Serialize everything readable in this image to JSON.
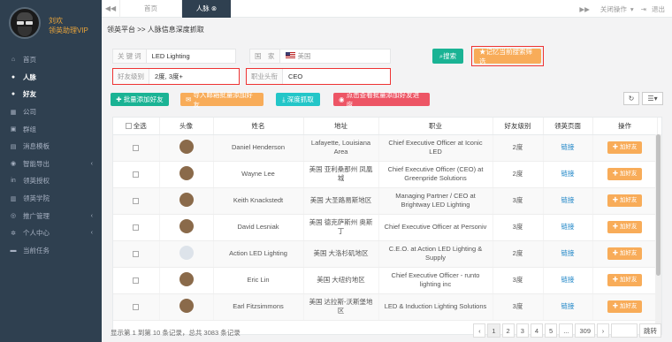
{
  "sidebar": {
    "user_name": "刘欢",
    "user_role": "领英助理VIP",
    "items": [
      {
        "label": "首页",
        "icon": "home-icon",
        "glyph": "⌂"
      },
      {
        "label": "人脉",
        "icon": "user-icon",
        "glyph": "●"
      },
      {
        "label": "好友",
        "icon": "user-plus-icon",
        "glyph": "●"
      },
      {
        "label": "公司",
        "icon": "building-icon",
        "glyph": "▦"
      },
      {
        "label": "群组",
        "icon": "group-icon",
        "glyph": "▣"
      },
      {
        "label": "消息模板",
        "icon": "template-icon",
        "glyph": "▤"
      },
      {
        "label": "智能导出",
        "icon": "export-icon",
        "glyph": "◉"
      },
      {
        "label": "领英授权",
        "icon": "linkedin-icon",
        "glyph": "in"
      },
      {
        "label": "领英学院",
        "icon": "academy-icon",
        "glyph": "▥"
      },
      {
        "label": "推广管理",
        "icon": "promo-icon",
        "glyph": "◎"
      },
      {
        "label": "个人中心",
        "icon": "gear-icon",
        "glyph": "✲"
      },
      {
        "label": "当前任务",
        "icon": "task-icon",
        "glyph": "▬"
      }
    ]
  },
  "topbar": {
    "tab_home": "首页",
    "tab_active": "人脉",
    "close_ops": "关闭操作",
    "logout": "退出"
  },
  "crumb": "领英平台 >> 人脉信息深度抓取",
  "form": {
    "keyword_label": "关 键 词",
    "keyword_value": "LED Lighting",
    "country_label": "国　家",
    "country_value": "美国",
    "friend_label": "好友级别",
    "friend_value": "2度, 3度+",
    "title_label": "职业头衔",
    "title_value": "CEO"
  },
  "buttons": {
    "search": "搜索",
    "remember": "★记忆当前搜索筛选",
    "batch_add": "批量添加好友",
    "import": "导入邮箱批量添加好友",
    "deep": "深度抓取",
    "progress": "点击查看批量添加好友进度"
  },
  "table": {
    "headers": [
      "全选",
      "头像",
      "姓名",
      "地址",
      "职业",
      "好友级别",
      "领英页面",
      "操作"
    ],
    "link_text": "链接",
    "add_text": "加好友",
    "rows": [
      {
        "name": "Daniel Henderson",
        "addr": "Lafayette, Louisiana Area",
        "job": "Chief Executive Officer at Iconic LED",
        "level": "2度"
      },
      {
        "name": "Wayne Lee",
        "addr": "美国 亚利桑那州 凤凰城",
        "job": "Chief Executive Officer (CEO) at Greenpride Solutions",
        "level": "2度"
      },
      {
        "name": "Keith Knackstedt",
        "addr": "美国 大圣路易斯地区",
        "job": "Managing Partner / CEO at Brightway LED Lighting",
        "level": "3度"
      },
      {
        "name": "David Lesniak",
        "addr": "美国 德克萨斯州 奥斯丁",
        "job": "Chief Executive Officer at Personiv",
        "level": "3度"
      },
      {
        "name": "Action LED Lighting",
        "addr": "美国 大洛杉矶地区",
        "job": "C.E.O. at Action LED Lighting & Supply",
        "level": "2度"
      },
      {
        "name": "Eric Lin",
        "addr": "美国 大纽约地区",
        "job": "Chief Executive Officer - runto lighting inc",
        "level": "3度"
      },
      {
        "name": "Earl Fitzsimmons",
        "addr": "美国 达拉斯-沃斯堡地区",
        "job": "LED & Induction Lighting Solutions",
        "level": "3度"
      }
    ]
  },
  "footer": {
    "summary": "显示第 1 到第 10 条记录，总共 3083 条记录",
    "pages": [
      "‹",
      "1",
      "2",
      "3",
      "4",
      "5",
      "...",
      "309",
      "›"
    ],
    "jump": "跳转"
  }
}
